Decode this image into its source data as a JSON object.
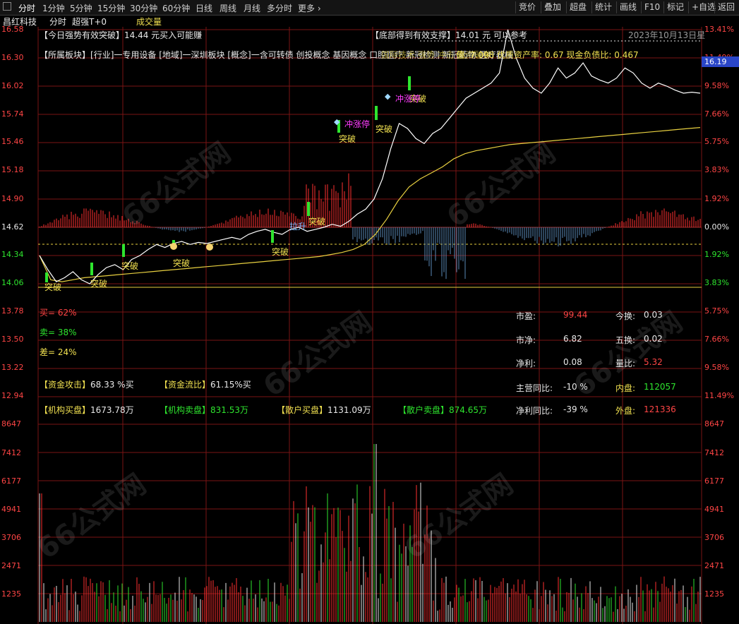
{
  "topbar": {
    "left_icon": "panel-toggle-icon",
    "tabs": [
      "分时",
      "1分钟",
      "5分钟",
      "15分钟",
      "30分钟",
      "60分钟",
      "日线",
      "周线",
      "月线",
      "多分时",
      "更多"
    ],
    "active_tab": "分时",
    "right_buttons": [
      "竞价",
      "叠加",
      "超盘",
      "统计",
      "画线",
      "F10",
      "标记",
      "+自选",
      "返回"
    ]
  },
  "info": {
    "stock_name": "昌红科技",
    "mode": "分时",
    "indicator": "超强T+0",
    "volume_label": "成交量"
  },
  "annotations": {
    "breakout_prefix": "【今日强势有效突破】",
    "breakout_text": "14.44 元买入可能赚",
    "support_prefix": "【底部得到有效支撑】",
    "support_text": "14.01 元 可以参考",
    "date": "2023年10月13日星",
    "sector_prefix": "【所属板块】",
    "sector_text": "[行业]一专用设备 [地域]一深圳板块 [概念]一含可转债 创投概念 基因概念 口腔医疗 新冠检测 新冠药物 医疗器械",
    "overlap_text": "国际技术 强势 冲击 融资融券",
    "value_text": "值: 7.098 优质资产率: 0.67 现金负债比: 0.467"
  },
  "signals": {
    "breakout": "突破",
    "limit_up_hit": "冲涨停",
    "pull_up": "拉升"
  },
  "current_price": "16.19",
  "price_axis": [
    "16.58",
    "16.30",
    "16.02",
    "15.74",
    "15.46",
    "15.18",
    "14.90",
    "14.62",
    "14.34",
    "14.06",
    "13.78",
    "13.50",
    "13.22",
    "12.94"
  ],
  "pct_axis": [
    "13.41%",
    "11.49%",
    "9.58%",
    "7.66%",
    "5.75%",
    "3.83%",
    "1.92%",
    "0.00%",
    "1.92%",
    "3.83%",
    "5.75%",
    "7.66%",
    "9.58%",
    "11.49%"
  ],
  "volume_axis": [
    "8647",
    "7412",
    "6177",
    "4941",
    "3706",
    "2471",
    "1235"
  ],
  "strength": {
    "buy": "买= 62%",
    "sell": "卖= 38%",
    "diff": "差= 24%"
  },
  "capital": {
    "attack_label": "【资金攻击】",
    "attack_value": "68.33 %买",
    "flow_label": "【资金流比】",
    "flow_value": "61.15%买",
    "inst_buy_label": "【机构买盘】",
    "inst_buy_value": "1673.78万",
    "inst_sell_label": "【机构卖盘】",
    "inst_sell_value": "831.53万",
    "retail_buy_label": "【散户买盘】",
    "retail_buy_value": "1131.09万",
    "retail_sell_label": "【散户卖盘】",
    "retail_sell_value": "874.65万"
  },
  "stats": {
    "pe_label": "市盈:",
    "pe_value": "99.44",
    "turnover_label": "今换:",
    "turnover_value": "0.03",
    "pb_label": "市净:",
    "pb_value": "6.82",
    "turnover5_label": "五换:",
    "turnover5_value": "0.02",
    "profit_label": "净利:",
    "profit_value": "0.08",
    "vol_ratio_label": "量比:",
    "vol_ratio_value": "5.32",
    "rev_yoy_label": "主营同比:",
    "rev_yoy_value": "-10 %",
    "inner_label": "内盘:",
    "inner_value": "112057",
    "profit_yoy_label": "净利同比:",
    "profit_yoy_value": "-39 %",
    "outer_label": "外盘:",
    "outer_value": "121336"
  },
  "watermark": "66公式网",
  "colors": {
    "up": "#ff4545",
    "down": "#2ee52e",
    "grid": "#7a1414",
    "price_line": "#ffffff",
    "avg_line": "#e8d040",
    "axis_text_red": "#ff4545",
    "current_price_bg": "#2a46c8"
  },
  "chart_data": {
    "type": "line",
    "prev_close": 14.62,
    "ylim": [
      12.94,
      16.58
    ],
    "price_series": [
      14.34,
      14.2,
      14.08,
      14.12,
      14.18,
      14.1,
      14.06,
      14.15,
      14.22,
      14.25,
      14.2,
      14.3,
      14.34,
      14.4,
      14.45,
      14.42,
      14.46,
      14.48,
      14.45,
      14.47,
      14.46,
      14.48,
      14.5,
      14.52,
      14.5,
      14.55,
      14.58,
      14.6,
      14.57,
      14.55,
      14.6,
      14.62,
      14.58,
      14.6,
      14.62,
      14.65,
      14.63,
      14.68,
      14.75,
      14.8,
      14.9,
      15.1,
      15.4,
      15.65,
      15.6,
      15.5,
      15.45,
      15.55,
      15.6,
      15.7,
      15.8,
      15.9,
      15.95,
      16.0,
      16.05,
      16.15,
      16.58,
      16.3,
      16.1,
      16.0,
      15.95,
      16.05,
      16.2,
      16.1,
      16.15,
      16.25,
      16.12,
      16.08,
      16.05,
      16.1,
      16.2,
      16.15,
      16.05,
      16.0,
      16.05,
      16.02,
      15.98,
      15.95,
      15.96,
      15.95
    ],
    "avg_series": [
      14.34,
      14.1,
      14.08,
      14.1,
      14.12,
      14.13,
      14.14,
      14.15,
      14.16,
      14.17,
      14.18,
      14.19,
      14.2,
      14.21,
      14.22,
      14.23,
      14.24,
      14.25,
      14.26,
      14.27,
      14.28,
      14.29,
      14.3,
      14.31,
      14.32,
      14.33,
      14.35,
      14.37,
      14.4,
      14.45,
      14.55,
      14.7,
      14.88,
      15.02,
      15.1,
      15.16,
      15.22,
      15.3,
      15.35,
      15.38,
      15.4,
      15.42,
      15.44,
      15.45,
      15.46,
      15.47,
      15.48,
      15.49,
      15.5,
      15.51,
      15.52,
      15.53,
      15.54,
      15.55,
      15.56,
      15.57,
      15.58,
      15.59,
      15.6,
      15.61
    ],
    "volume_max": 8647
  }
}
